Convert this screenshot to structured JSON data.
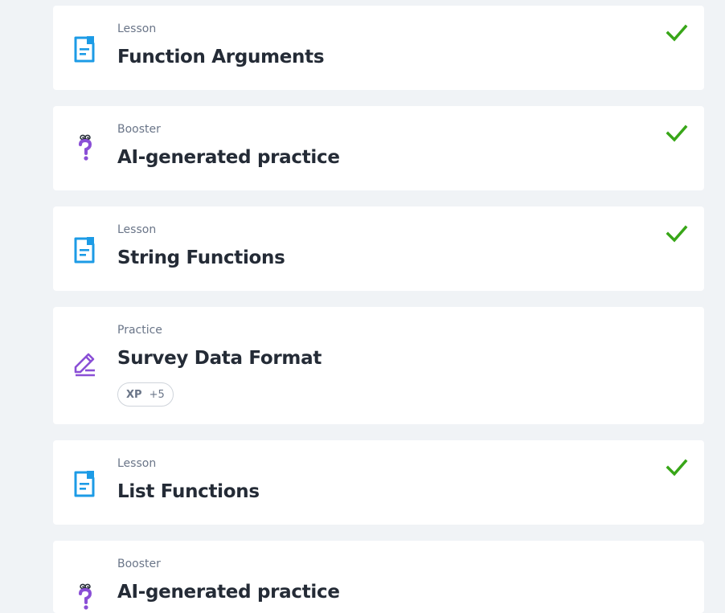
{
  "items": [
    {
      "type": "Lesson",
      "title": "Function Arguments",
      "completed": true,
      "icon": "lesson-doc-icon"
    },
    {
      "type": "Booster",
      "title": "AI-generated practice",
      "completed": true,
      "icon": "question-mark-icon"
    },
    {
      "type": "Lesson",
      "title": "String Functions",
      "completed": true,
      "icon": "lesson-doc-icon"
    },
    {
      "type": "Practice",
      "title": "Survey Data Format",
      "completed": false,
      "icon": "pencil-edit-icon",
      "xp_label": "XP",
      "xp_value": "+5"
    },
    {
      "type": "Lesson",
      "title": "List Functions",
      "completed": true,
      "icon": "lesson-doc-icon"
    },
    {
      "type": "Booster",
      "title": "AI-generated practice",
      "completed": false,
      "icon": "question-mark-icon"
    }
  ],
  "colors": {
    "lesson_icon": "#1c9be6",
    "booster_icon": "#8a4fd6",
    "check": "#38a618",
    "title": "#242b36",
    "label": "#6a7588",
    "background": "#f0f3f6"
  }
}
